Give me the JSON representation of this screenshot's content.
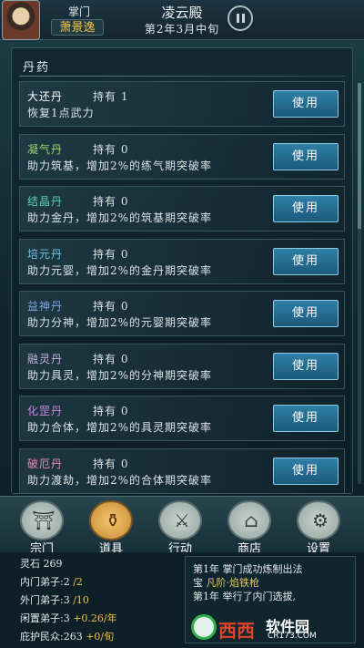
{
  "header": {
    "role_label": "掌门",
    "player_name": "萧景逸",
    "place_name": "凌云殿",
    "game_date": "第2年3月中旬"
  },
  "panel": {
    "title": "丹药",
    "items": [
      {
        "name": "大还丹",
        "held": "持有 1",
        "desc": "恢复1点武力",
        "color": "#ffffff",
        "use": "使用"
      },
      {
        "name": "凝气丹",
        "held": "持有 0",
        "desc": "助力筑基，增加2%的练气期突破率",
        "color": "#9ed36a",
        "use": "使用"
      },
      {
        "name": "结晶丹",
        "held": "持有 0",
        "desc": "助力金丹，增加2%的筑基期突破率",
        "color": "#59d1b3",
        "use": "使用"
      },
      {
        "name": "培元丹",
        "held": "持有 0",
        "desc": "助力元婴，增加2%的金丹期突破率",
        "color": "#6fc4e6",
        "use": "使用"
      },
      {
        "name": "益神丹",
        "held": "持有 0",
        "desc": "助力分神，增加2%的元婴期突破率",
        "color": "#7fa6e0",
        "use": "使用"
      },
      {
        "name": "融灵丹",
        "held": "持有 0",
        "desc": "助力具灵，增加2%的分神期突破率",
        "color": "#c5b2e0",
        "use": "使用"
      },
      {
        "name": "化罡丹",
        "held": "持有 0",
        "desc": "助力合体，增加2%的具灵期突破率",
        "color": "#c788e0",
        "use": "使用"
      },
      {
        "name": "破厄丹",
        "held": "持有 0",
        "desc": "助力渡劫，增加2%的合体期突破率",
        "color": "#f08ab4",
        "use": "使用"
      }
    ]
  },
  "nav": [
    {
      "label": "宗门",
      "glyph": "⛩",
      "active": false
    },
    {
      "label": "道具",
      "glyph": "⚱",
      "active": true
    },
    {
      "label": "行动",
      "glyph": "⚔",
      "active": false
    },
    {
      "label": "商店",
      "glyph": "⌂",
      "active": false
    },
    {
      "label": "设置",
      "glyph": "⚙",
      "active": false
    }
  ],
  "stats": {
    "spirit_stones_label": "灵石",
    "spirit_stones": "269",
    "inner_label": "内门弟子:",
    "inner_value": "2",
    "inner_cap": "/2",
    "outer_label": "外门弟子:",
    "outer_value": "3",
    "outer_cap": "/10",
    "idle_label": "闲置弟子:",
    "idle_value": "3",
    "idle_gain": "+0.26/年",
    "shelter_label": "庇护民众:",
    "shelter_value": "263",
    "shelter_gain": "+0/旬"
  },
  "log": {
    "line1": "第1年 掌门成功炼制出法",
    "line2_prefix": "宝 ",
    "line2_highlight": "凡阶·焰铁枪",
    "line3": "第1年 举行了内门选拔,"
  },
  "watermark": {
    "brand": "西西",
    "text": "软件园",
    "url": "CR173.COM"
  }
}
